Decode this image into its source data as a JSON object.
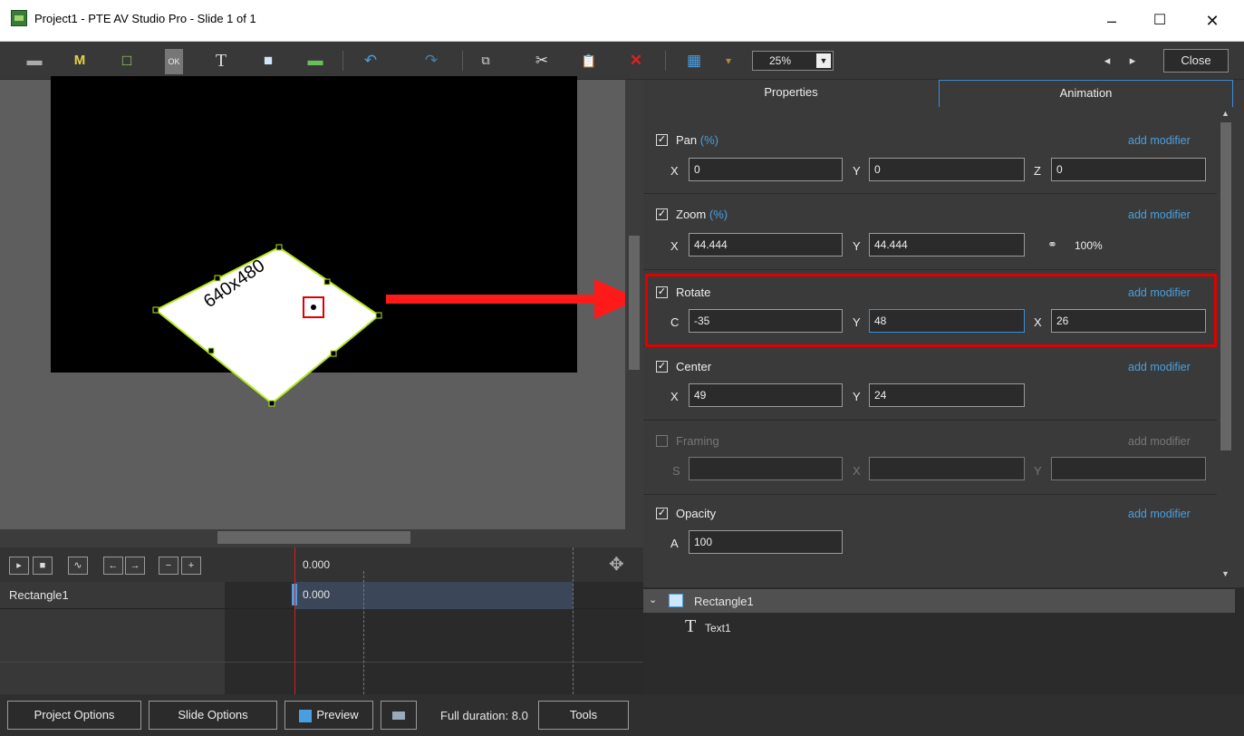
{
  "window": {
    "title": "Project1 - PTE AV Studio Pro - Slide 1 of 1",
    "min": "–",
    "max": "☐",
    "close": "✕"
  },
  "toolbar": {
    "icons": [
      "camera-icon",
      "M",
      "□",
      "OK",
      "T",
      "■",
      "▬",
      "↶",
      "↷",
      "⧉",
      "✂",
      "📋",
      "✕",
      "▦",
      "▾"
    ],
    "zoom": "25%",
    "nav_prev": "◂",
    "nav_next": "▸",
    "close_label": "Close"
  },
  "canvas": {
    "object_label": "640x480"
  },
  "timeline": {
    "buttons": [
      "▸",
      "■",
      "∿",
      "←",
      "→",
      "−",
      "+"
    ],
    "time": "0.000",
    "track_name": "Rectangle1",
    "track_time": "0.000"
  },
  "tabs": {
    "properties": "Properties",
    "animation": "Animation"
  },
  "sections": {
    "pan": {
      "label": "Pan",
      "unit": "(%)",
      "modifier": "add modifier",
      "x_label": "X",
      "x": "0",
      "y_label": "Y",
      "y": "0",
      "z_label": "Z",
      "z": "0"
    },
    "zoom": {
      "label": "Zoom",
      "unit": "(%)",
      "modifier": "add modifier",
      "x_label": "X",
      "x": "44.444",
      "y_label": "Y",
      "y": "44.444",
      "ratio": "100%"
    },
    "rotate": {
      "label": "Rotate",
      "modifier": "add modifier",
      "c_label": "C",
      "c": "-35",
      "y_label": "Y",
      "y": "48",
      "x_label": "X",
      "x": "26"
    },
    "center": {
      "label": "Center",
      "modifier": "add modifier",
      "x_label": "X",
      "x": "49",
      "y_label": "Y",
      "y": "24"
    },
    "framing": {
      "label": "Framing",
      "modifier": "add modifier",
      "s_label": "S",
      "x_label": "X",
      "y_label": "Y"
    },
    "opacity": {
      "label": "Opacity",
      "modifier": "add modifier",
      "a_label": "A",
      "a": "100"
    }
  },
  "tree": {
    "root": "Rectangle1",
    "child": "Text1"
  },
  "bottom": {
    "project_options": "Project Options",
    "slide_options": "Slide Options",
    "preview": "Preview",
    "full_duration": "Full duration: 8.0",
    "tools": "Tools"
  },
  "colors": {
    "accent": "#4a9fe0",
    "highlight": "#e00000",
    "arrow": "#ff1a1a",
    "handles": "#b5e61d"
  }
}
